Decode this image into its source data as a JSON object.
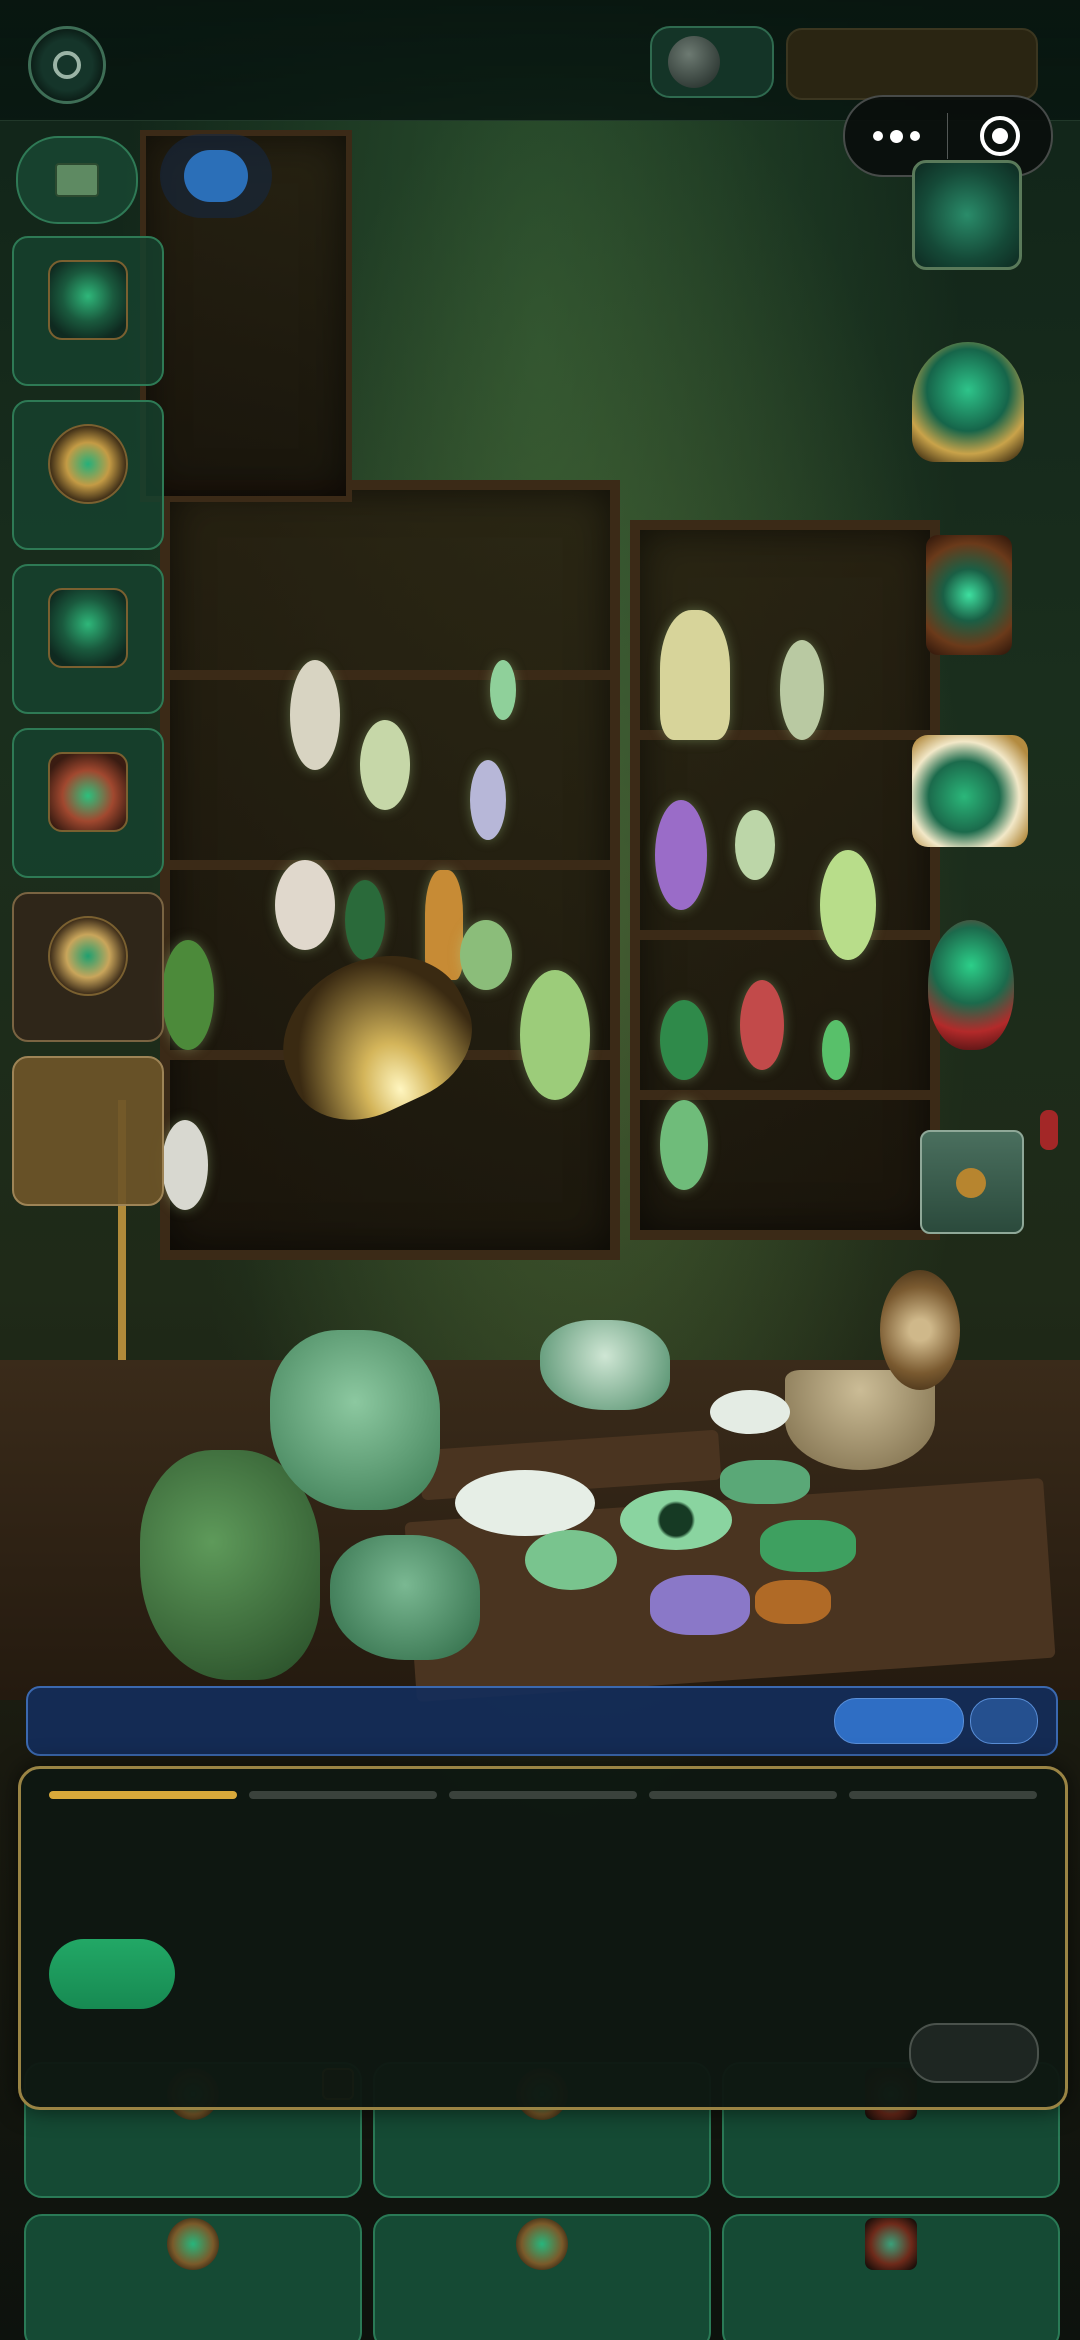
{
  "colors": {
    "accent_gold": "#d9a93a",
    "dialog_border": "#9a8444",
    "primary_blue": "#2f6ec4",
    "primary_green": "#22a866",
    "card_green": "#154a34"
  },
  "topbar": {
    "left_icon": "coin-icon",
    "currency_icon": "gem-orb-icon"
  },
  "capsule": {
    "more_icon": "more-dots-icon",
    "close_icon": "target-close-icon"
  },
  "left_panel": {
    "badge_icon": "banknote-icon",
    "cards": [
      {
        "icon": "treasure-chest-icon"
      },
      {
        "icon": "jade-medallion-icon"
      },
      {
        "icon": "jade-cabinet-icon"
      },
      {
        "icon": "jade-chest-icon"
      },
      {
        "icon": "jade-clock-icon"
      },
      {
        "icon": "empty-slot-icon"
      }
    ]
  },
  "right_panel": {
    "icons": [
      "jade-book-icon",
      "trophy-icon",
      "lantern-clock-icon",
      "growth-chart-icon",
      "dragon-amulet-icon",
      "mail-envelope-icon"
    ]
  },
  "dialog": {
    "progress": {
      "total_steps": 5,
      "current_step": 1
    }
  },
  "bottom_grid": {
    "cards": [
      {
        "icon": "jade-pot-icon"
      },
      {
        "icon": "jade-lantern-icon"
      },
      {
        "icon": "jade-camera-icon"
      },
      {
        "icon": "jade-coin-icon"
      },
      {
        "icon": "jade-compass-icon"
      },
      {
        "icon": "jade-shrine-icon"
      }
    ]
  }
}
